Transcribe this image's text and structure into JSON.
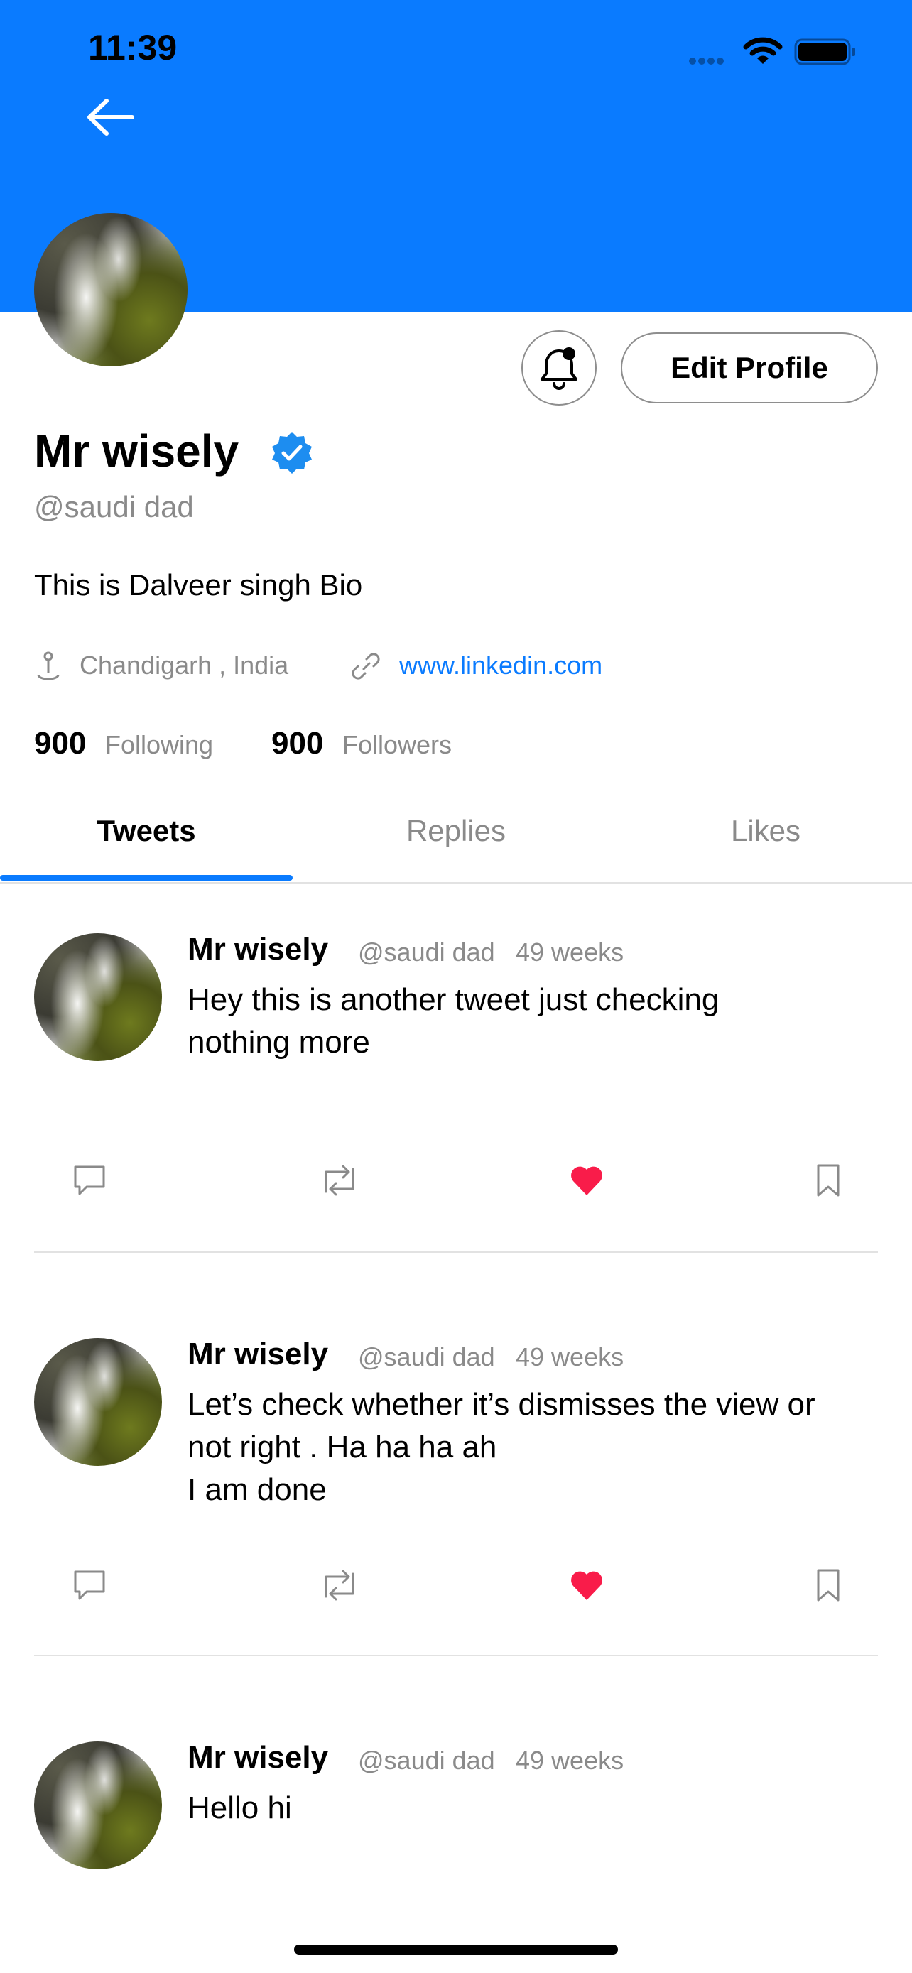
{
  "status_bar": {
    "time": "11:39"
  },
  "header": {
    "accent_color": "#0a7bff",
    "back_icon": "arrow-left-icon"
  },
  "profile": {
    "display_name": "Mr wisely",
    "handle": "@saudi dad",
    "bio": "This is Dalveer singh Bio",
    "location": "Chandigarh , India",
    "website": "www.linkedin.com",
    "following_count": "900",
    "following_label": "Following",
    "followers_count": "900",
    "followers_label": "Followers",
    "edit_button_label": "Edit Profile",
    "verified": true
  },
  "tabs": [
    {
      "label": "Tweets",
      "active": true
    },
    {
      "label": "Replies",
      "active": false
    },
    {
      "label": "Likes",
      "active": false
    }
  ],
  "tweets": [
    {
      "name": "Mr wisely",
      "handle": "@saudi dad",
      "time": "49 weeks",
      "text": "Hey this is another tweet just checking\nnothing more",
      "liked": true
    },
    {
      "name": "Mr wisely",
      "handle": "@saudi dad",
      "time": "49 weeks",
      "text": "Let’s check whether it’s dismisses the view or\nnot right . Ha ha ha ah\nI am done",
      "liked": true
    },
    {
      "name": "Mr wisely",
      "handle": "@saudi dad",
      "time": "49 weeks",
      "text": "Hello hi",
      "liked": false
    }
  ],
  "colors": {
    "like": "#f91c4a",
    "muted": "#8a8a8a",
    "link": "#0a7bff"
  }
}
